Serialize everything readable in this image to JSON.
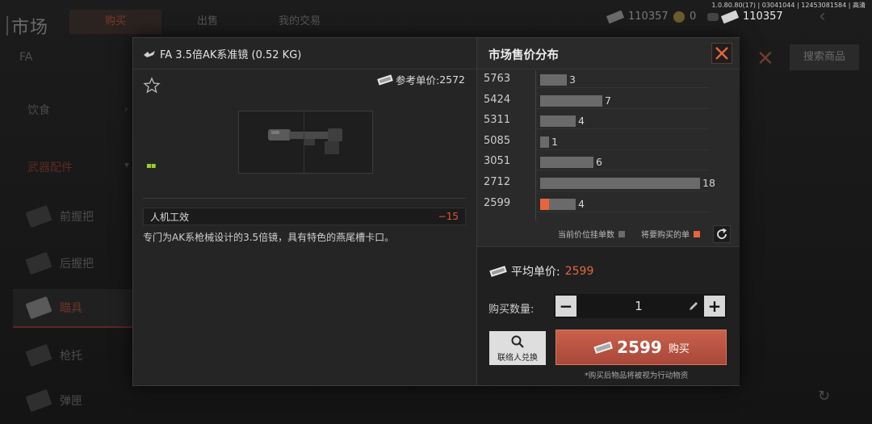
{
  "version": "1.0.80.80(17) | 03041044 | 12453081584 | 高清",
  "currency": {
    "cash_bg": "110357",
    "coins": "0",
    "cash_main": "110357"
  },
  "background": {
    "title": "市场",
    "tabs": [
      "购买",
      "出售",
      "我的交易"
    ],
    "search_text": "FA",
    "search_button": "搜索商品",
    "category_food": "饮食",
    "category_group": "武器配件",
    "categories": [
      {
        "label": "前握把"
      },
      {
        "label": "后握把"
      },
      {
        "label": "瞄具"
      },
      {
        "label": "枪托"
      },
      {
        "label": "弹匣"
      }
    ]
  },
  "item": {
    "name": "FA 3.5倍AK系准镜 (0.52 KG)",
    "ref_price_label": "参考单价:",
    "ref_price": "2572",
    "quality_mark": "▪▪",
    "stat_name": "人机工效",
    "stat_value": "−15",
    "description": "专门为AK系枪械设计的3.5倍镜，具有特色的燕尾槽卡口。"
  },
  "distribution": {
    "title": "市场售价分布",
    "legend_current": "当前价位挂单数",
    "legend_mine": "将要购买的单"
  },
  "chart_data": {
    "type": "bar",
    "orientation": "horizontal",
    "categories": [
      "5763",
      "5424",
      "5311",
      "5085",
      "3051",
      "2712",
      "2599"
    ],
    "series": [
      {
        "name": "当前价位挂单数",
        "values": [
          3,
          7,
          4,
          1,
          6,
          18,
          4
        ]
      },
      {
        "name": "将要购买的单",
        "values": [
          0,
          0,
          0,
          0,
          0,
          0,
          1
        ]
      }
    ],
    "xlim": [
      0,
      18
    ],
    "colors": {
      "listing": "#6a6a6a",
      "mine": "#e6653f"
    }
  },
  "purchase": {
    "avg_label": "平均单价:",
    "avg_price": "2599",
    "qty_label": "购买数量:",
    "qty_minus": "−",
    "qty_plus": "+",
    "qty_value": "1",
    "contact_label": "联络人兑换",
    "buy_price": "2599",
    "buy_label": "购买",
    "note": "*购买后物品将被视为行动物资"
  },
  "colors": {
    "accent": "#e6653f",
    "buy_button": "#b8523f",
    "loss_stat": "#e0553b"
  }
}
